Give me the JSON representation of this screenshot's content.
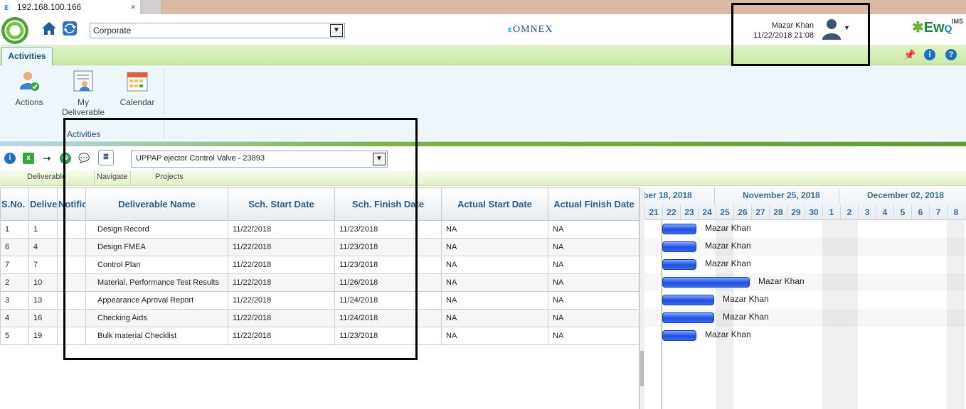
{
  "browser": {
    "tab_title": "192.168.100.166",
    "close_glyph": "×"
  },
  "header": {
    "company_select": "Corporate",
    "brand_center": "OMNEX",
    "user_name": "Mazar Khan",
    "user_datetime": "11/22/2018 21:08",
    "brand_right": "Ew",
    "brand_right_suffix": "IMS"
  },
  "ribbon": {
    "tab": "Activities",
    "items": [
      {
        "label": "Actions",
        "icon": "actions-icon"
      },
      {
        "label": "My Deliverable List",
        "icon": "deliverable-list-icon"
      },
      {
        "label": "Calendar",
        "icon": "calendar-icon"
      }
    ],
    "group": "Activities"
  },
  "toolbar": {
    "project_select": "UPPAP ejector Control Valve - 23893",
    "labels": {
      "deliverable": "Deliverable",
      "navigate": "Navigate",
      "projects": "Projects"
    }
  },
  "grid": {
    "columns": [
      "S.No.",
      "Delive",
      "Notific",
      "Deliverable Name",
      "Sch. Start Date",
      "Sch. Finish Date",
      "Actual Start Date",
      "Actual Finish Date"
    ],
    "rows": [
      {
        "sno": "1",
        "deliv": "1",
        "name": "Design Record",
        "start": "11/22/2018",
        "finish": "11/23/2018",
        "astart": "NA",
        "afinish": "NA"
      },
      {
        "sno": "6",
        "deliv": "4",
        "name": "Design FMEA",
        "start": "11/22/2018",
        "finish": "11/23/2018",
        "astart": "NA",
        "afinish": "NA"
      },
      {
        "sno": "7",
        "deliv": "7",
        "name": "Control Plan",
        "start": "11/22/2018",
        "finish": "11/23/2018",
        "astart": "NA",
        "afinish": "NA"
      },
      {
        "sno": "2",
        "deliv": "10",
        "name": "Material, Performance Test Results",
        "start": "11/22/2018",
        "finish": "11/26/2018",
        "astart": "NA",
        "afinish": "NA"
      },
      {
        "sno": "3",
        "deliv": "13",
        "name": "Appearance Aproval Report",
        "start": "11/22/2018",
        "finish": "11/24/2018",
        "astart": "NA",
        "afinish": "NA"
      },
      {
        "sno": "4",
        "deliv": "16",
        "name": "Checking Aids",
        "start": "11/22/2018",
        "finish": "11/24/2018",
        "astart": "NA",
        "afinish": "NA"
      },
      {
        "sno": "5",
        "deliv": "19",
        "name": "Bulk material Checklist",
        "start": "11/22/2018",
        "finish": "11/23/2018",
        "astart": "NA",
        "afinish": "NA"
      }
    ]
  },
  "gantt": {
    "weeks": [
      "ber 18, 2018",
      "November 25, 2018",
      "December 02, 2018"
    ],
    "days": [
      "21",
      "22",
      "23",
      "24",
      "25",
      "26",
      "27",
      "28",
      "29",
      "30",
      "1",
      "2",
      "3",
      "4",
      "5",
      "6",
      "7",
      "8"
    ],
    "bars": [
      {
        "label": "Mazar Khan",
        "days": 2
      },
      {
        "label": "Mazar Khan",
        "days": 2
      },
      {
        "label": "Mazar Khan",
        "days": 2
      },
      {
        "label": "Mazar Khan",
        "days": 5
      },
      {
        "label": "Mazar Khan",
        "days": 3
      },
      {
        "label": "Mazar Khan",
        "days": 3
      },
      {
        "label": "Mazar Khan",
        "days": 2
      }
    ]
  }
}
